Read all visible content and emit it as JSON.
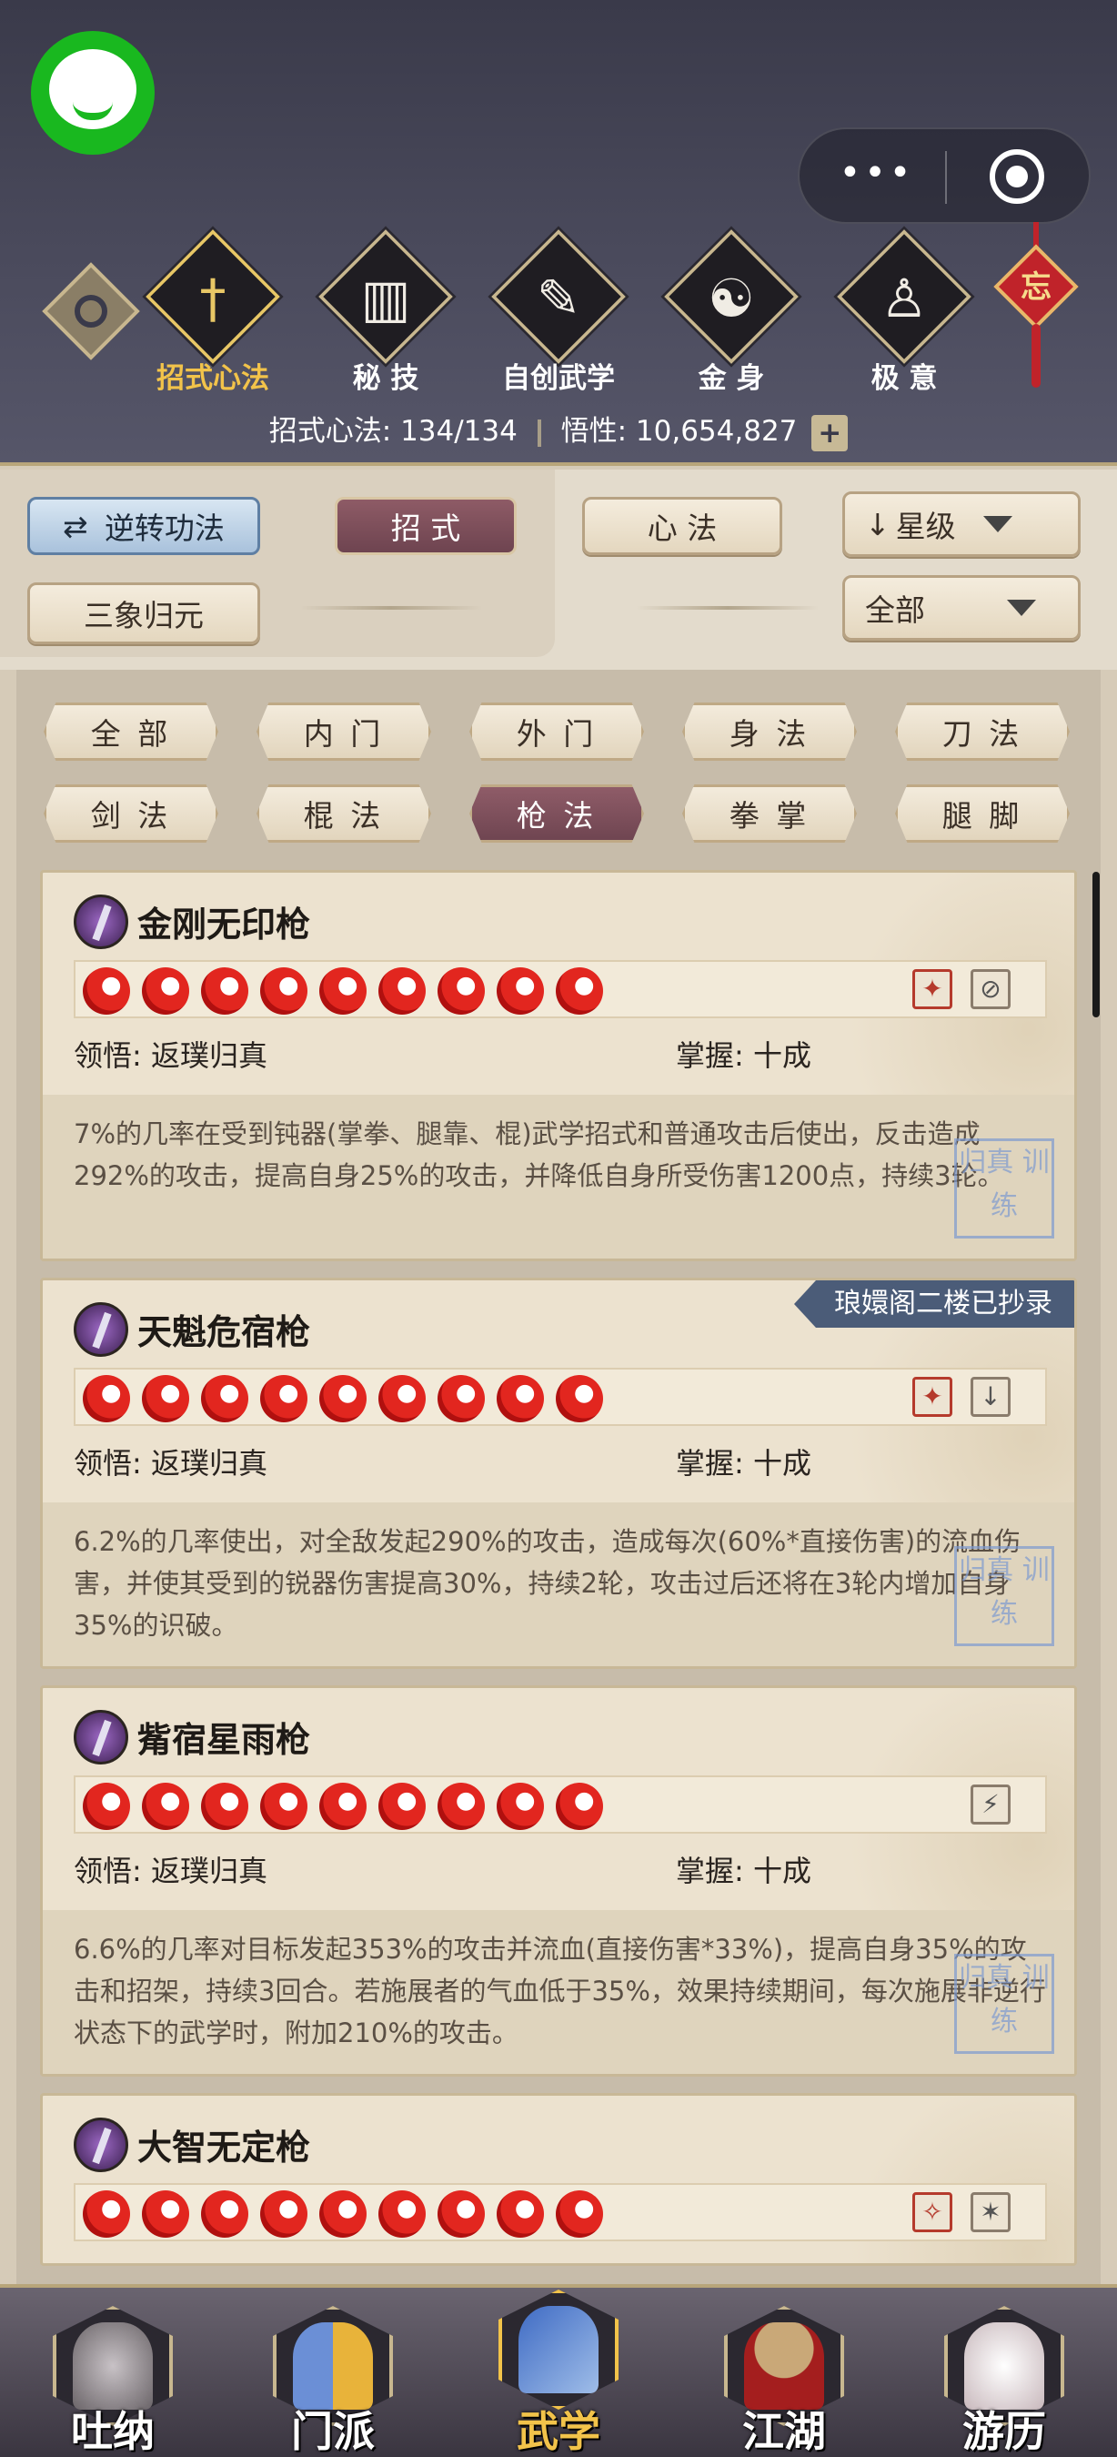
{
  "header": {
    "capsule_dots": "•••",
    "eye_icon": "eye-icon",
    "categories": [
      {
        "label": "招式心法",
        "icon": "sword-icon",
        "glyph": "†",
        "active": true
      },
      {
        "label": "秘 技",
        "icon": "book-icon",
        "glyph": "▥",
        "active": false
      },
      {
        "label": "自创武学",
        "icon": "scroll-icon",
        "glyph": "✎",
        "active": false
      },
      {
        "label": "金 身",
        "icon": "meditation-icon",
        "glyph": "☯",
        "active": false
      },
      {
        "label": "极 意",
        "icon": "martial-pose-icon",
        "glyph": "♙",
        "active": false
      }
    ],
    "knot_char": "忘",
    "stats": {
      "label1": "招式心法:",
      "value1": "134/134",
      "label2": "悟性:",
      "value2": "10,654,827",
      "plus": "+"
    }
  },
  "controls": {
    "reverse": "逆转功法",
    "tab_moves": "招 式",
    "tab_heart": "心 法",
    "sort": "星级",
    "sanxiang": "三象归元",
    "filter_all": "全部"
  },
  "filters": [
    "全 部",
    "内 门",
    "外 门",
    "身 法",
    "刀 法",
    "剑 法",
    "棍 法",
    "枪 法",
    "拳 掌",
    "腿 脚"
  ],
  "selected_filter": "枪 法",
  "cards": [
    {
      "name": "金刚无印枪",
      "stars": 9,
      "effects": [
        "✦",
        "⊘"
      ],
      "comprehension_label": "领悟:",
      "comprehension": "返璞归真",
      "mastery_label": "掌握:",
      "mastery": "十成",
      "desc": "7%的几率在受到钝器(掌拳、腿靠、棍)武学招式和普通攻击后使出，反击造成292%的攻击，提高自身25%的攻击，并降低自身所受伤害1200点，持续3轮。",
      "ribbon": ""
    },
    {
      "name": "天魁危宿枪",
      "stars": 9,
      "effects": [
        "✦",
        "↓"
      ],
      "comprehension_label": "领悟:",
      "comprehension": "返璞归真",
      "mastery_label": "掌握:",
      "mastery": "十成",
      "desc": "6.2%的几率使出，对全敌发起290%的攻击，造成每次(60%*直接伤害)的流血伤害，并使其受到的锐器伤害提高30%，持续2轮，攻击过后还将在3轮内增加自身35%的识破。",
      "ribbon": "琅嬛阁二楼已抄录"
    },
    {
      "name": "觜宿星雨枪",
      "stars": 9,
      "effects": [
        "⚡"
      ],
      "comprehension_label": "领悟:",
      "comprehension": "返璞归真",
      "mastery_label": "掌握:",
      "mastery": "十成",
      "desc": "6.6%的几率对目标发起353%的攻击并流血(直接伤害*33%)，提高自身35%的攻击和招架，持续3回合。若施展者的气血低于35%，效果持续期间，每次施展非逆行状态下的武学时，附加210%的攻击。",
      "ribbon": ""
    },
    {
      "name": "大智无定枪",
      "stars": 9,
      "effects": [
        "✧",
        "✶"
      ],
      "comprehension_label": "",
      "comprehension": "",
      "mastery_label": "",
      "mastery": "",
      "desc": "",
      "ribbon": ""
    }
  ],
  "seal_text": "归真 训练",
  "bottom_nav": [
    {
      "label": "吐纳",
      "icon": "breathing-figure-icon",
      "active": false
    },
    {
      "label": "门派",
      "icon": "sect-icon",
      "active": false
    },
    {
      "label": "武学",
      "icon": "martial-book-icon",
      "active": true
    },
    {
      "label": "江湖",
      "icon": "straw-hat-icon",
      "active": false
    },
    {
      "label": "游历",
      "icon": "white-horse-icon",
      "active": false
    }
  ]
}
